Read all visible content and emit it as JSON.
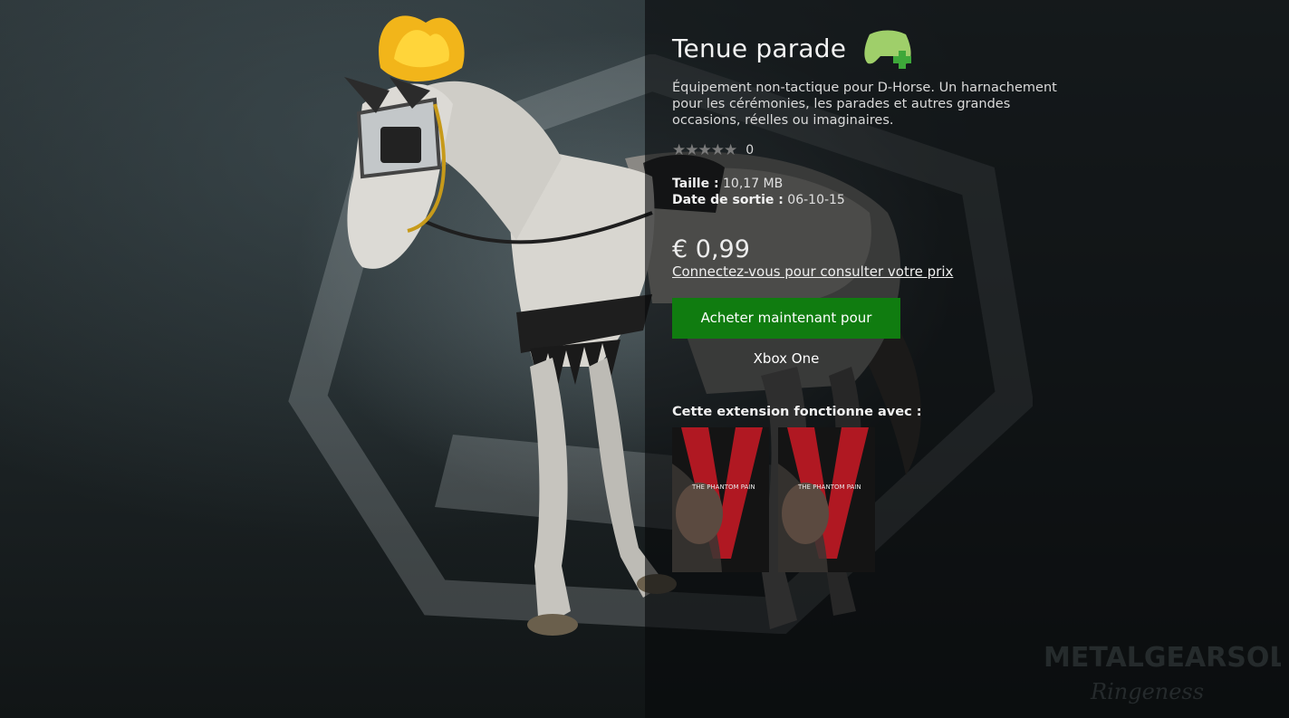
{
  "product": {
    "title": "Tenue parade",
    "description": "Équipement non-tactique pour D-Horse. Un harnachement pour les cérémonies, les parades et autres grandes occasions, réelles ou imaginaires.",
    "rating": {
      "stars_display": "★★★★★",
      "count": "0"
    },
    "size_label": "Taille :",
    "size_value": "10,17 MB",
    "release_label": "Date de sortie :",
    "release_value": "06-10-15",
    "price": "€ 0,99",
    "login_link": "Connectez-vous pour consulter votre prix",
    "buy_button": "Acheter maintenant pour Xbox One"
  },
  "compatibility": {
    "label": "Cette extension fonctionne avec :",
    "games": [
      {
        "cover_text": "THE PHANTOM PAIN"
      },
      {
        "cover_text": "THE PHANTOM PAIN"
      }
    ]
  },
  "colors": {
    "accent_green": "#107c10",
    "controller_icon": "#9fcf6a",
    "plus_icon": "#3ea83a"
  },
  "watermark": {
    "line1": "METALGEARSOLID",
    "line2": "Ringeness"
  }
}
